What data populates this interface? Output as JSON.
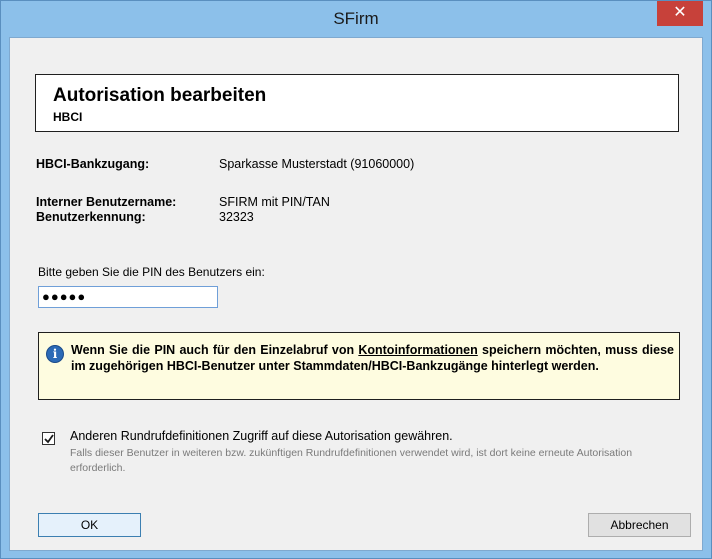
{
  "window": {
    "title": "SFirm",
    "close_glyph": "✕"
  },
  "header": {
    "title": "Autorisation bearbeiten",
    "subtitle": "HBCI"
  },
  "fields": {
    "bankzugang_label": "HBCI-Bankzugang:",
    "bankzugang_value": "Sparkasse Musterstadt (91060000)",
    "benutzername_label": "Interner Benutzername:",
    "benutzername_value": "SFIRM mit PIN/TAN",
    "benutzerkennung_label": "Benutzerkennung:",
    "benutzerkennung_value": "32323"
  },
  "pin": {
    "prompt": "Bitte geben Sie die PIN des Benutzers ein:",
    "value": "●●●●●"
  },
  "info": {
    "icon": "info-icon",
    "text_part1": "Wenn Sie die PIN auch für den Einzelabruf von ",
    "text_link": "Kontoinformationen",
    "text_part2": " speichern möchten, muss diese im zugehörigen HBCI-Benutzer unter Stammdaten/HBCI-Bankzugänge hinterlegt werden."
  },
  "option": {
    "checked": true,
    "label": "Anderen Rundrufdefinitionen Zugriff auf diese Autorisation gewähren.",
    "hint": "Falls dieser Benutzer in weiteren bzw. zukünftigen Rundrufdefinitionen verwendet wird, ist dort keine erneute Autorisation erforderlich."
  },
  "buttons": {
    "ok": "OK",
    "cancel": "Abbrechen"
  }
}
